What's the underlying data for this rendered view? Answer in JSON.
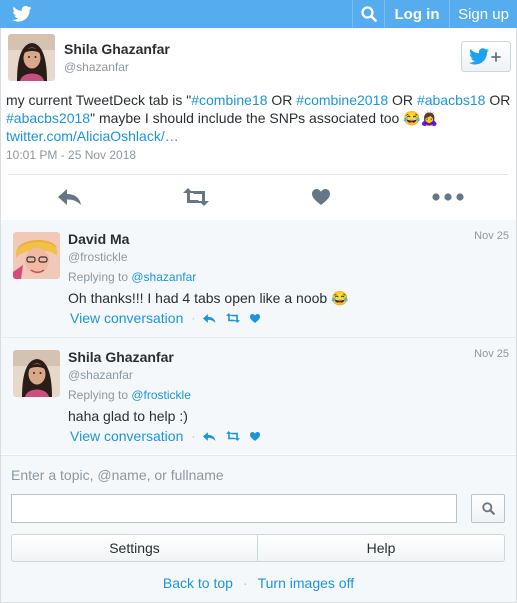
{
  "colors": {
    "brand": "#55acee",
    "link": "#1b95e0",
    "muted": "#8899a6"
  },
  "topbar": {
    "logo_icon": "twitter-bird-icon",
    "search_icon": "search-icon",
    "login_label": "Log in",
    "signup_label": "Sign up"
  },
  "tweet": {
    "name": "Shila Ghazanfar",
    "handle": "@shazanfar",
    "follow_icon": "follow-bird-plus-icon",
    "text": {
      "p1": "my current TweetDeck tab is \"",
      "h1": "#combine18",
      "p2": " OR ",
      "h2": "#combine2018",
      "p3": " OR ",
      "h3": "#abacbs18",
      "p4": " OR ",
      "h4": "#abacbs2018",
      "p5": "\" maybe I should include the SNPs associated too 😂🙇‍♀️",
      "link": "twitter.com/AliciaOshlack/…"
    },
    "timestamp": "10:01 PM - 25 Nov 2018",
    "actions": [
      "reply-icon",
      "retweet-icon",
      "like-icon",
      "more-icon"
    ]
  },
  "replies": [
    {
      "name": "David Ma",
      "handle": "@frostickle",
      "date": "Nov 25",
      "replying_prefix": "Replying to ",
      "replying_to": "@shazanfar",
      "text": "Oh thanks!!! I had 4 tabs open like a noob 😂",
      "view_label": "View conversation"
    },
    {
      "name": "Shila Ghazanfar",
      "handle": "@shazanfar",
      "date": "Nov 25",
      "replying_prefix": "Replying to ",
      "replying_to": "@frostickle",
      "text": "haha glad to help :)",
      "view_label": "View conversation"
    }
  ],
  "search": {
    "label": "Enter a topic, @name, or fullname",
    "value": "",
    "button_icon": "search-icon"
  },
  "buttons": {
    "settings": "Settings",
    "help": "Help"
  },
  "footer": {
    "back_to_top": "Back to top",
    "separator": "·",
    "images_off": "Turn images off"
  }
}
